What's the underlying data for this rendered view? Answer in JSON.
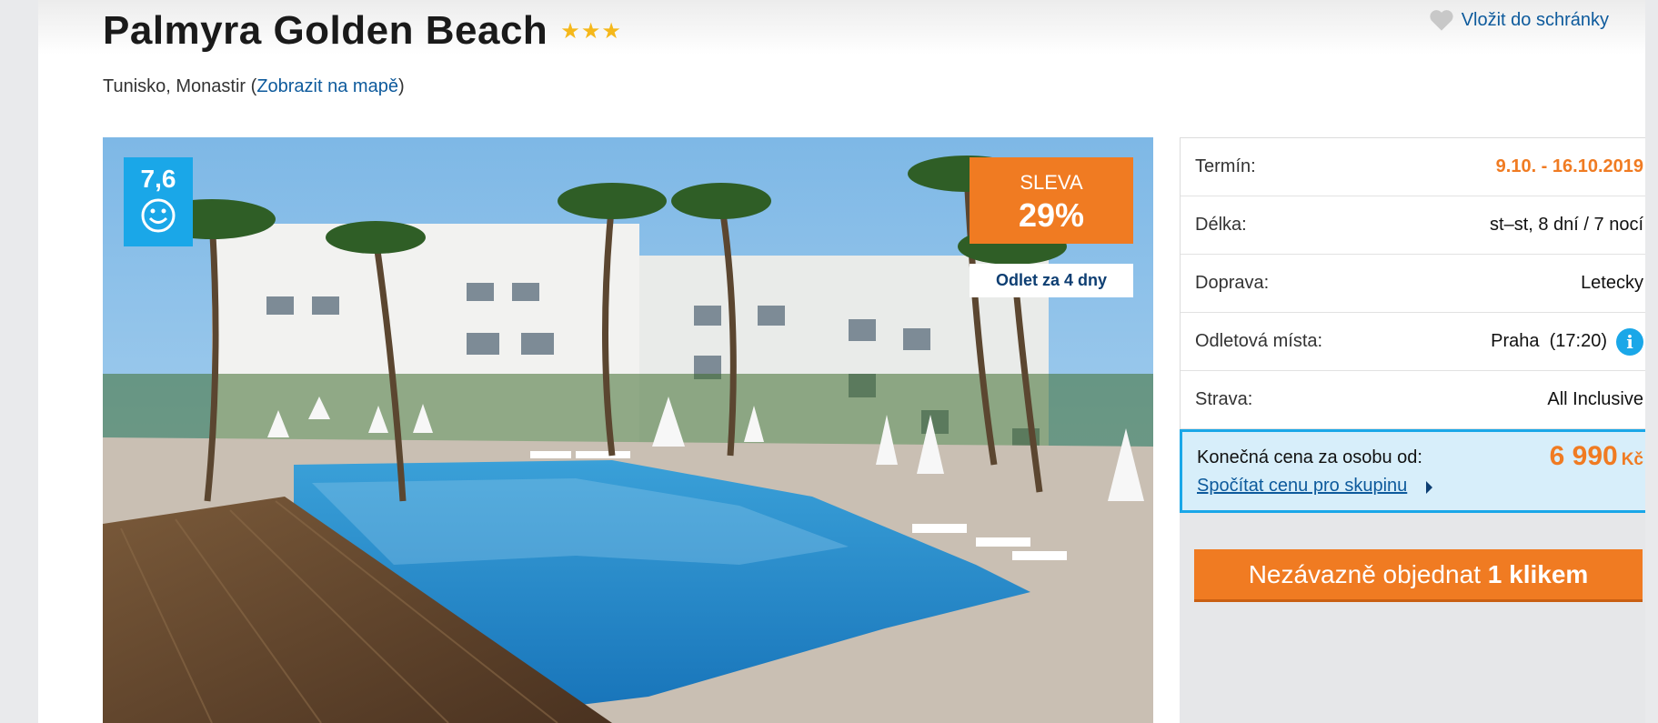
{
  "hotel": {
    "name": "Palmyra Golden Beach",
    "stars": "★★★",
    "location_prefix": "Tunisko, Monastir (",
    "map_link": "Zobrazit na mapě",
    "location_suffix": ")"
  },
  "favorite": {
    "label": "Vložit do schránky"
  },
  "photo": {
    "rating": "7,6",
    "discount_label": "SLEVA",
    "discount_value": "29%",
    "departure_badge": "Odlet za 4 dny"
  },
  "details": {
    "rows": [
      {
        "key": "Termín:",
        "value": "9.10. - 16.10.2019"
      },
      {
        "key": "Délka:",
        "value": "st–st, 8 dní / 7 nocí"
      },
      {
        "key": "Doprava:",
        "value": "Letecky"
      },
      {
        "key": "Odletová místa:",
        "value": "Praha  (17:20)"
      },
      {
        "key": "Strava:",
        "value": "All Inclusive"
      }
    ]
  },
  "price": {
    "label": "Konečná cena za osobu od:",
    "amount": "6 990",
    "currency": "Kč",
    "group_link": "Spočítat cenu pro skupinu"
  },
  "order": {
    "label_plain": "Nezávazně objednat ",
    "label_bold": "1 klikem"
  },
  "colors": {
    "accent_orange": "#f07b22",
    "accent_blue": "#1aa7e8",
    "link_blue": "#0d5a9c"
  }
}
